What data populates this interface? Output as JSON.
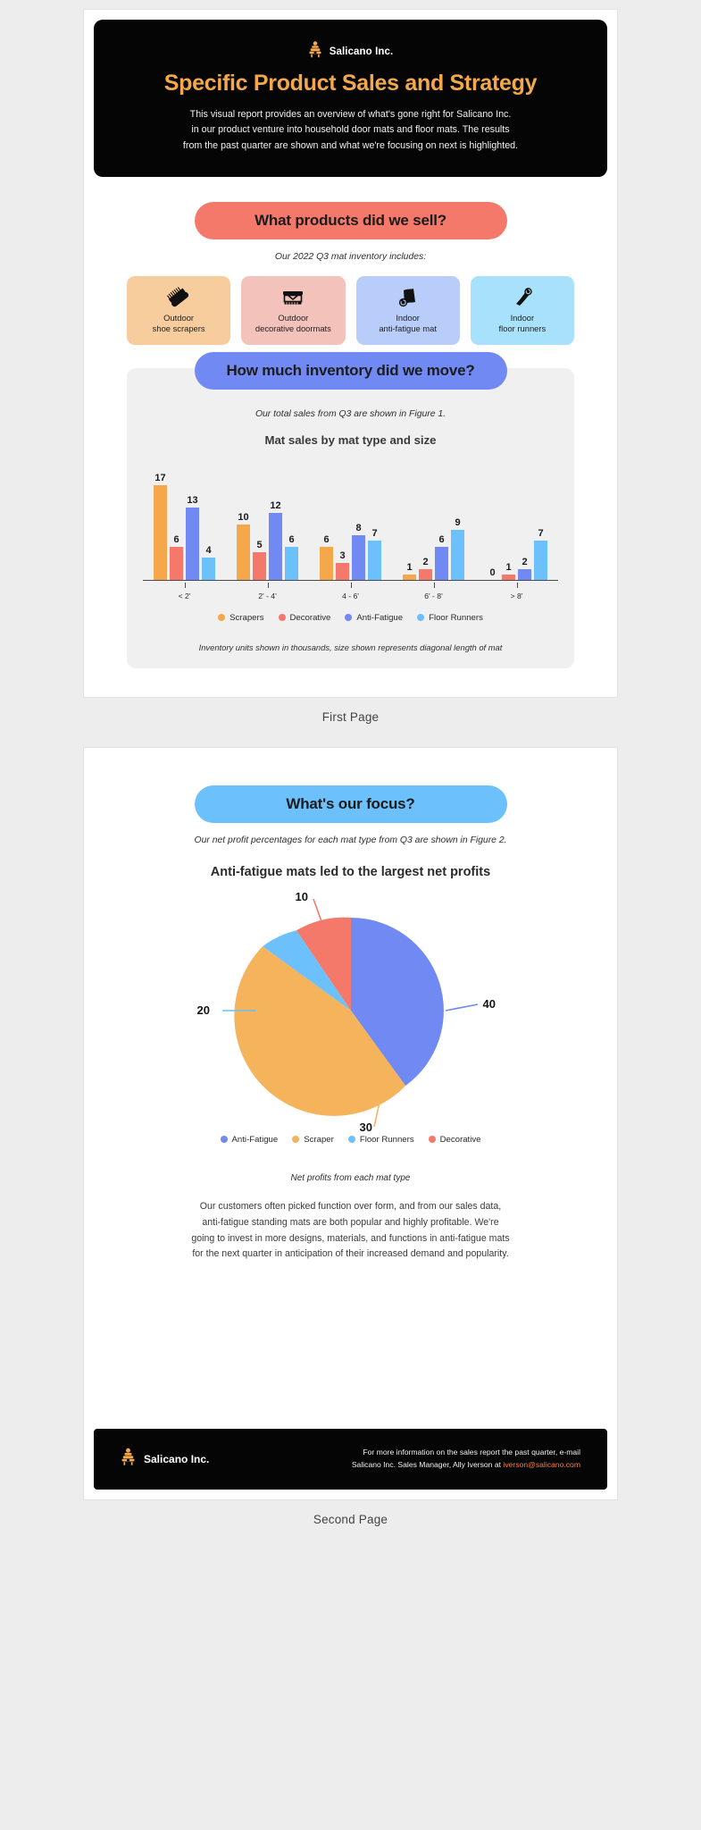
{
  "brand": {
    "name": "Salicano Inc.",
    "logo_icon": "beehive-icon",
    "accent": "#f5a84b"
  },
  "hero": {
    "title": "Specific Product Sales and Strategy",
    "line1": "This visual report provides an overview of what's gone right for Salicano Inc.",
    "line2": "in our product venture into household door mats and floor mats. The results",
    "line3": "from the past quarter are shown and what we're focusing on next is highlighted."
  },
  "section_products": {
    "pill": "What products did we sell?",
    "caption": "Our 2022 Q3 mat inventory includes:",
    "cards": [
      {
        "icon": "shoe-scraper-brush-icon",
        "line1": "Outdoor",
        "line2": "shoe scrapers",
        "bg": "#f7cd9e"
      },
      {
        "icon": "doormat-icon",
        "line1": "Outdoor",
        "line2": "decorative doormats",
        "bg": "#f3c3bb"
      },
      {
        "icon": "rolled-mat-icon",
        "line1": "Indoor",
        "line2": "anti-fatigue mat",
        "bg": "#b8cdf9"
      },
      {
        "icon": "floor-runner-icon",
        "line1": "Indoor",
        "line2": "floor runners",
        "bg": "#a8e1fb"
      }
    ]
  },
  "section_inventory": {
    "pill": "How much inventory did we move?",
    "caption": "Our total sales from Q3 are shown in Figure 1.",
    "note": "Inventory units shown in thousands, size shown represents diagonal length of mat"
  },
  "section_focus": {
    "pill": "What's our focus?",
    "caption": "Our net profit percentages for each mat type from Q3 are shown in Figure 2.",
    "note": "Net profits from each mat type",
    "body_line1": "Our customers often picked function over form, and from our sales data,",
    "body_line2": "anti-fatigue standing mats are both popular and highly profitable. We're",
    "body_line3": "going to invest in more designs, materials, and functions in anti-fatigue mats",
    "body_line4": "for the next quarter in anticipation of their increased demand and popularity."
  },
  "footer": {
    "brand": "Salicano Inc.",
    "line1": "For more information on the sales report the past quarter, e-mail",
    "line2_prefix": "Salicano Inc. Sales Manager, Ally Iverson at ",
    "email": "iverson@salicano.com"
  },
  "page_labels": {
    "first": "First Page",
    "second": "Second Page"
  },
  "chart_data": [
    {
      "type": "bar",
      "title": "Mat sales by mat type and size",
      "xlabel": "",
      "ylabel": "",
      "ylim": [
        0,
        18
      ],
      "grid": false,
      "legend_position": "bottom",
      "categories": [
        "< 2'",
        "2' - 4'",
        "4 - 6'",
        "6' - 8'",
        "> 8'"
      ],
      "series": [
        {
          "name": "Scrapers",
          "color": "#f5a84b",
          "values": [
            17,
            10,
            6,
            1,
            0
          ]
        },
        {
          "name": "Decorative",
          "color": "#f4796b",
          "values": [
            6,
            5,
            3,
            2,
            1
          ]
        },
        {
          "name": "Anti-Fatigue",
          "color": "#7189f2",
          "values": [
            13,
            12,
            8,
            6,
            2
          ]
        },
        {
          "name": "Floor Runners",
          "color": "#6cc0fb",
          "values": [
            4,
            6,
            7,
            9,
            7
          ]
        }
      ]
    },
    {
      "type": "pie",
      "title": "Anti-fatigue mats led to the largest net profits",
      "labels": [
        "Anti-Fatigue",
        "Scraper",
        "Floor Runners",
        "Decorative"
      ],
      "values": [
        40,
        30,
        20,
        10
      ],
      "colors": [
        "#7189f2",
        "#f5b košt",
        "#6cc0fb",
        "#f4796b"
      ],
      "legend_position": "bottom"
    }
  ]
}
